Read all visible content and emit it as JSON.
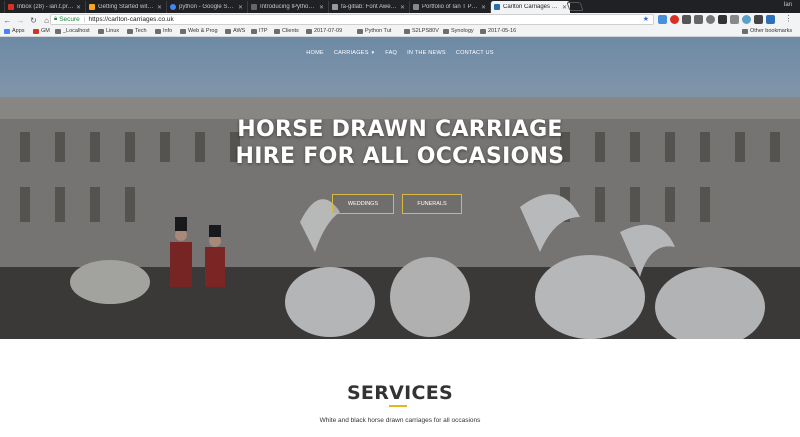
{
  "browser": {
    "tabs": [
      {
        "title": "Inbox (28) - ian.t.prin…",
        "favicon_color": "#d93025"
      },
      {
        "title": "Getting Started with A…",
        "favicon_color": "#f5a623"
      },
      {
        "title": "python - Google Search",
        "favicon_color": "#4285f4"
      },
      {
        "title": "Introducing IPython — I…",
        "favicon_color": "#444444"
      },
      {
        "title": "fa-gitlab: Font Awesom…",
        "favicon_color": "#333333"
      },
      {
        "title": "Portfolio of Ian T Price…",
        "favicon_color": "#777777"
      },
      {
        "title": "Carlton Carriages Hors…",
        "favicon_color": "#2a6db0"
      }
    ],
    "profile_name": "Ian",
    "omnibox": {
      "secure_label": "Secure",
      "url": "https://carlton-carriages.co.uk"
    },
    "bookmarks": [
      {
        "label": "Apps",
        "icon": "apps-icon"
      },
      {
        "label": "GM",
        "icon": "gmail-icon"
      },
      {
        "label": "_Localhost",
        "icon": "folder-icon"
      },
      {
        "label": "Linux",
        "icon": "folder-icon"
      },
      {
        "label": "Tech",
        "icon": "folder-icon"
      },
      {
        "label": "Info",
        "icon": "folder-icon"
      },
      {
        "label": "Web & Prog",
        "icon": "folder-icon"
      },
      {
        "label": "AWS",
        "icon": "folder-icon"
      },
      {
        "label": "ITP",
        "icon": "folder-icon"
      },
      {
        "label": "Clients",
        "icon": "folder-icon"
      },
      {
        "label": "2017-07-09",
        "icon": "folder-icon"
      },
      {
        "label": "Python Tut",
        "icon": "folder-icon"
      },
      {
        "label": "S2LPS80V",
        "icon": "folder-icon"
      },
      {
        "label": "Synology",
        "icon": "folder-icon"
      },
      {
        "label": "2017-05-16",
        "icon": "folder-icon"
      }
    ],
    "other_bookmarks": "Other bookmarks"
  },
  "site": {
    "nav": [
      {
        "label": "HOME"
      },
      {
        "label": "CARRIAGES",
        "has_dropdown": true
      },
      {
        "label": "FAQ"
      },
      {
        "label": "IN THE NEWS"
      },
      {
        "label": "CONTACT US"
      }
    ],
    "hero": {
      "headline_line1": "HORSE DRAWN CARRIAGE",
      "headline_line2": "HIRE FOR ALL OCCASIONS",
      "buttons": [
        "WEDDINGS",
        "FUNERALS"
      ],
      "button_border_color": "#d9b945"
    },
    "services": {
      "title": "SERVICES",
      "subtitle": "White and black horse drawn carriages for all occasions",
      "accent_color": "#e0b81e"
    }
  }
}
